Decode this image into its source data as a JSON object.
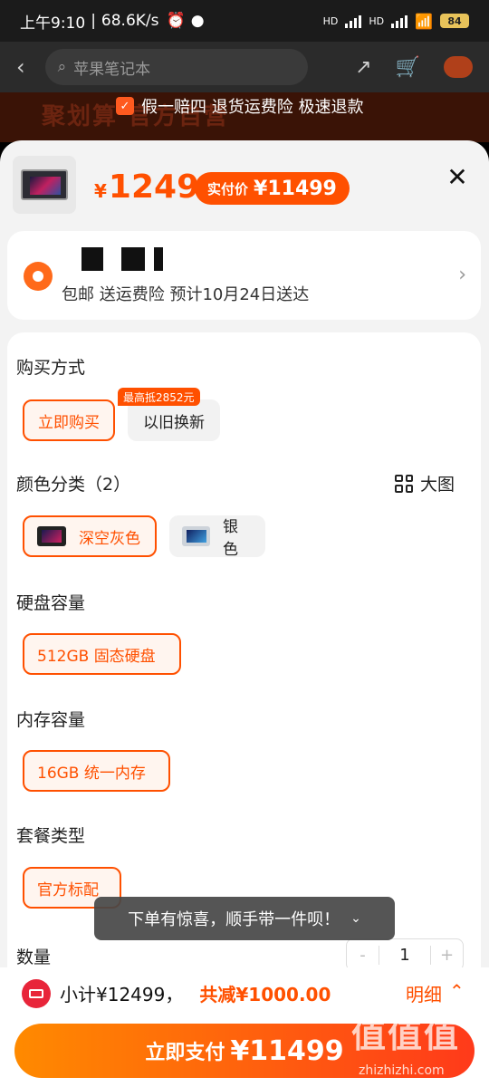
{
  "status_bar": {
    "time": "上午9:10",
    "net_speed": "68.6K/s",
    "battery": "84",
    "sig1": "HD",
    "sig2": "HD"
  },
  "header": {
    "search_placeholder": "苹果笔记本"
  },
  "banner": {
    "ghost_text": "聚划算 官方自营",
    "promo": "假一赔四 退货运费险 极速退款"
  },
  "product": {
    "price_symbol": "¥",
    "price": "12499",
    "real_label": "实付价",
    "real_price": "¥11499"
  },
  "address": {
    "shipping": "包邮  送运费险  预计10月24日送达"
  },
  "options": {
    "purchase": {
      "title": "购买方式",
      "buy_now": "立即购买",
      "trade_in": "以旧换新",
      "trade_tag": "最高抵2852元"
    },
    "color": {
      "title": "颜色分类（2）",
      "big_view": "大图",
      "items": [
        "深空灰色",
        "银色"
      ]
    },
    "disk": {
      "title": "硬盘容量",
      "value": "512GB 固态硬盘"
    },
    "memory": {
      "title": "内存容量",
      "value": "16GB 统一内存"
    },
    "package": {
      "title": "套餐类型",
      "value": "官方标配"
    },
    "qty": {
      "title": "数量",
      "minus": "-",
      "value": "1",
      "plus": "+"
    }
  },
  "toast": {
    "text": "下单有惊喜，顺手带一件呗！"
  },
  "bottom": {
    "subtotal": "小计¥12499，",
    "discount": "共减¥1000.00",
    "detail": "明细",
    "pay_label": "立即支付",
    "pay_amount": "¥11499"
  },
  "watermark": {
    "brand": "值值值",
    "site": "zhizhizhi.com"
  }
}
